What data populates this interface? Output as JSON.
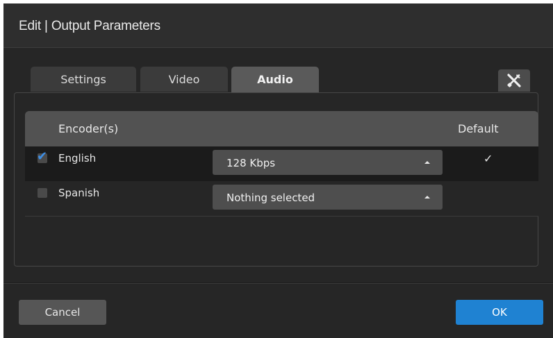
{
  "dialog": {
    "title": "Edit | Output Parameters"
  },
  "tabs": [
    {
      "label": "Settings",
      "active": false
    },
    {
      "label": "Video",
      "active": false
    },
    {
      "label": "Audio",
      "active": true
    }
  ],
  "tools_icon": "tools-icon",
  "table": {
    "headers": {
      "encoders": "Encoder(s)",
      "default": "Default"
    },
    "rows": [
      {
        "language": "English",
        "checked": true,
        "bitrate": "128 Kbps",
        "default_mark": "✓"
      },
      {
        "language": "Spanish",
        "checked": false,
        "bitrate": "Nothing selected",
        "default_mark": ""
      }
    ]
  },
  "footer": {
    "cancel_label": "Cancel",
    "ok_label": "OK"
  },
  "colors": {
    "accent": "#1f82d2",
    "check": "#3d8fe6"
  }
}
